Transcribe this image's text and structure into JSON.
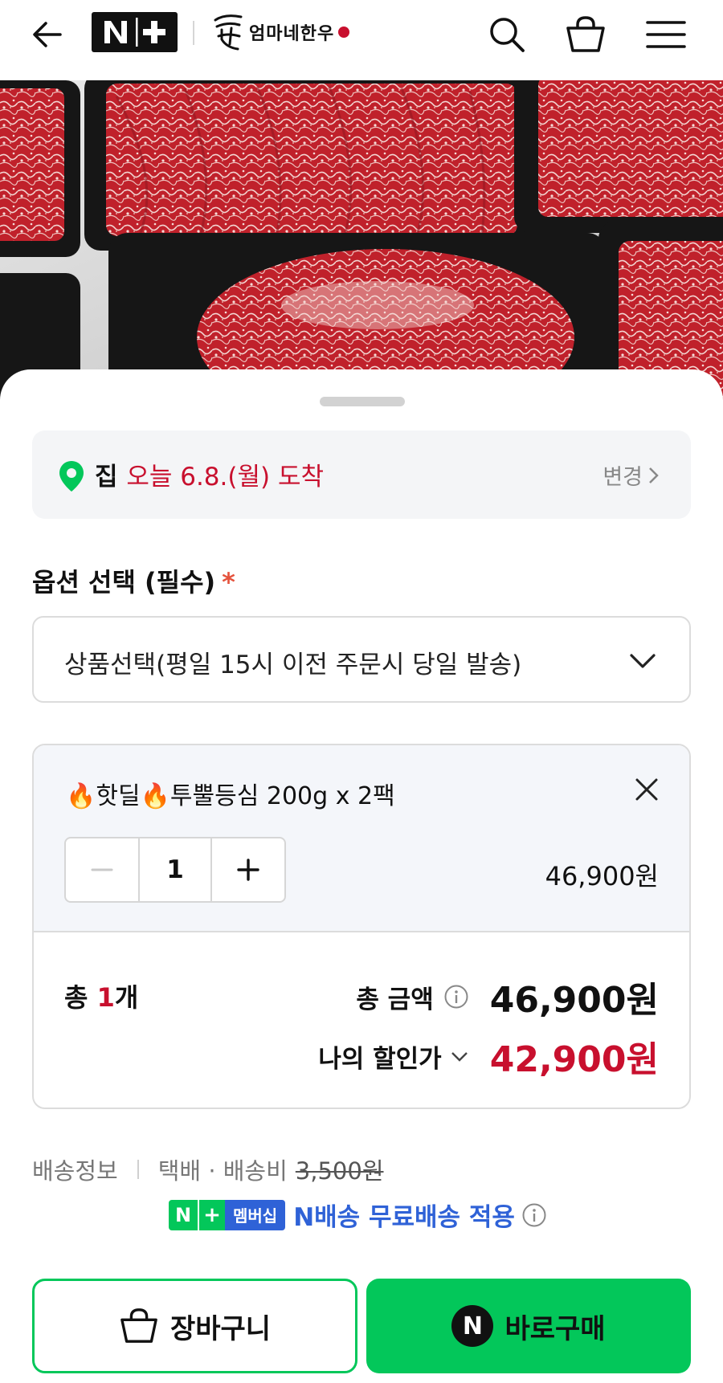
{
  "header": {
    "back_icon": "arrow-left-icon",
    "nplus_logo_n": "N",
    "nplus_logo_plus": "+",
    "brand_name": "엄마네한우",
    "search_icon": "search-icon",
    "bag_icon": "shopping-bag-icon",
    "menu_icon": "hamburger-menu-icon"
  },
  "hero": {
    "image": "raw beef cuts in black trays"
  },
  "delivery": {
    "place": "집",
    "arrival": "오늘 6.8.(월) 도착",
    "change_label": "변경"
  },
  "option": {
    "label": "옵션 선택 (필수)",
    "required_mark": "*",
    "select_value": "상품선택(평일 15시 이전 주문시 당일 발송)"
  },
  "cart_item": {
    "name_prefix_1": "🔥",
    "name_part_1": "핫딜",
    "name_prefix_2": "🔥",
    "name_part_2": "투뿔등심 200g x 2팩",
    "quantity": "1",
    "price": "46,900원"
  },
  "totals": {
    "count_label": "총",
    "count_value": "1",
    "count_unit": "개",
    "total_label": "총 금액",
    "total_amount": "46,900원",
    "discount_label": "나의 할인가",
    "discount_amount": "42,900원"
  },
  "shipping": {
    "info_label": "배송정보",
    "method": "택배 · 배송비",
    "fee": "3,500원",
    "badge_n": "N",
    "badge_plus": "+",
    "badge_text": "멤버십",
    "free_text": "N배송 무료배송 적용"
  },
  "actions": {
    "cart_label": "장바구니",
    "buy_n": "N",
    "buy_label": "바로구매"
  },
  "colors": {
    "accent_green": "#03c75a",
    "price_red": "#c8102e",
    "link_blue": "#2f62d7"
  }
}
